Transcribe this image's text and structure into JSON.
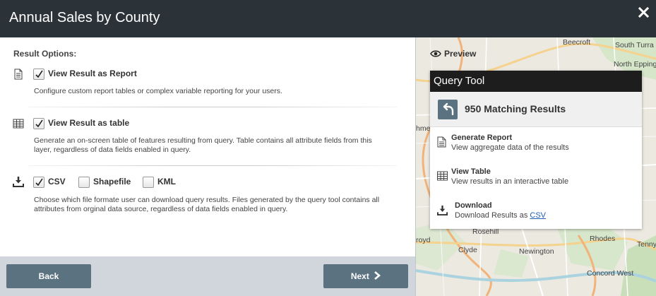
{
  "header": {
    "title": "Annual Sales by County"
  },
  "options": {
    "label": "Result Options:",
    "report": {
      "checked": true,
      "title": "View Result as Report",
      "desc": "Configure custom report tables or complex variable reporting for your users."
    },
    "table": {
      "checked": true,
      "title": "View Result as table",
      "desc": "Generate an on-screen table of features resulting from query. Table contains all attribute fields from this layer, regardless of data fields enabled in query."
    },
    "download": {
      "formats": [
        {
          "label": "CSV",
          "checked": true
        },
        {
          "label": "Shapefile",
          "checked": false
        },
        {
          "label": "KML",
          "checked": false
        }
      ],
      "desc": "Choose which file formate user can download query results. Files generated by the query tool contains all attributes from orginal data source, regardless of data fields enabled in query."
    }
  },
  "footer": {
    "back_label": "Back",
    "next_label": "Next"
  },
  "preview": {
    "label": "Preview"
  },
  "map_labels": [
    "Beecroft",
    "South Turra",
    "North Epping",
    "hme",
    "Rosehill",
    "Clyde",
    "Newington",
    "Rhodes",
    "Tenny",
    "Concord West",
    "royd"
  ],
  "query_tool": {
    "title": "Query Tool",
    "count_label": "950 Matching Results",
    "items": [
      {
        "title": "Generate Report",
        "desc": "View aggregate data of the results"
      },
      {
        "title": "View Table",
        "desc": "View results in an interactive table"
      },
      {
        "title": "Download",
        "desc": "Download Results as",
        "link": "CSV"
      }
    ]
  },
  "colors": {
    "header_bg": "#2b3338",
    "button_bg": "#5b7280",
    "footer_bg": "#d0d6db",
    "link": "#1f5fb8"
  },
  "icons": [
    "close-icon",
    "document-icon",
    "table-icon",
    "download-icon",
    "checkmark-icon",
    "eye-icon",
    "back-arrow-icon",
    "chevron-right-icon"
  ]
}
